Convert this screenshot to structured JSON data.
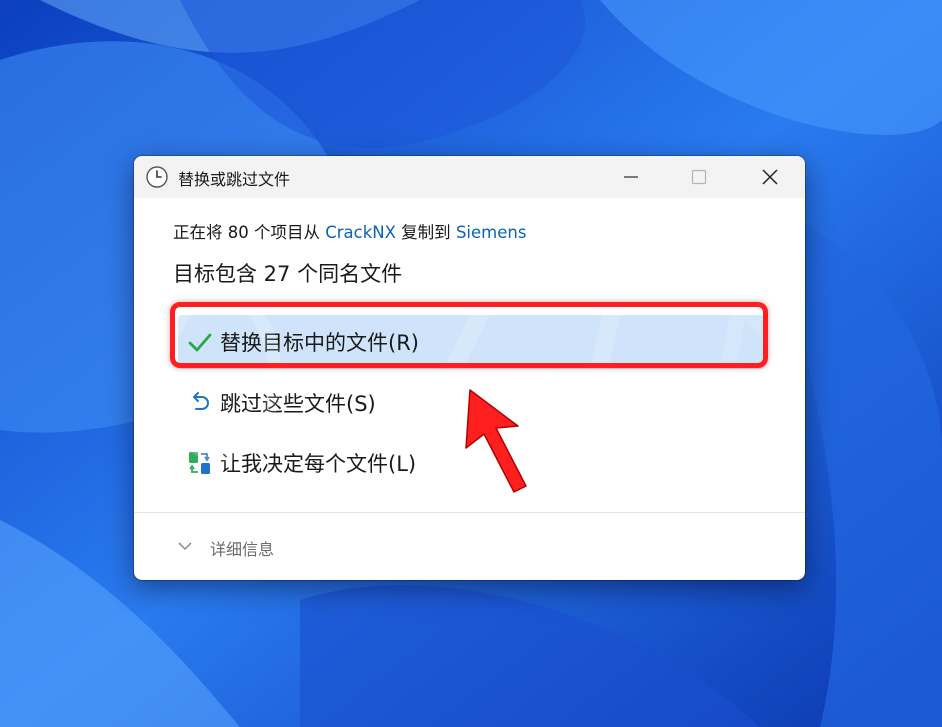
{
  "dialog": {
    "title": "替换或跳过文件",
    "copy_prefix": "正在将 80 个项目从 ",
    "source": "CrackNX",
    "copy_middle": " 复制到 ",
    "destination": "Siemens",
    "heading": "目标包含 27 个同名文件",
    "options": [
      {
        "label": "替换目标中的文件(R)",
        "icon": "checkmark-icon"
      },
      {
        "label": "跳过这些文件(S)",
        "icon": "undo-arrow-icon"
      },
      {
        "label": "让我决定每个文件(L)",
        "icon": "compare-files-icon"
      }
    ],
    "details_label": "详细信息"
  },
  "colors": {
    "link": "#0a64b8",
    "selected_option_bg": "#cfe4fa",
    "annotation_red": "#ff1f1f",
    "check_green": "#27a745"
  }
}
